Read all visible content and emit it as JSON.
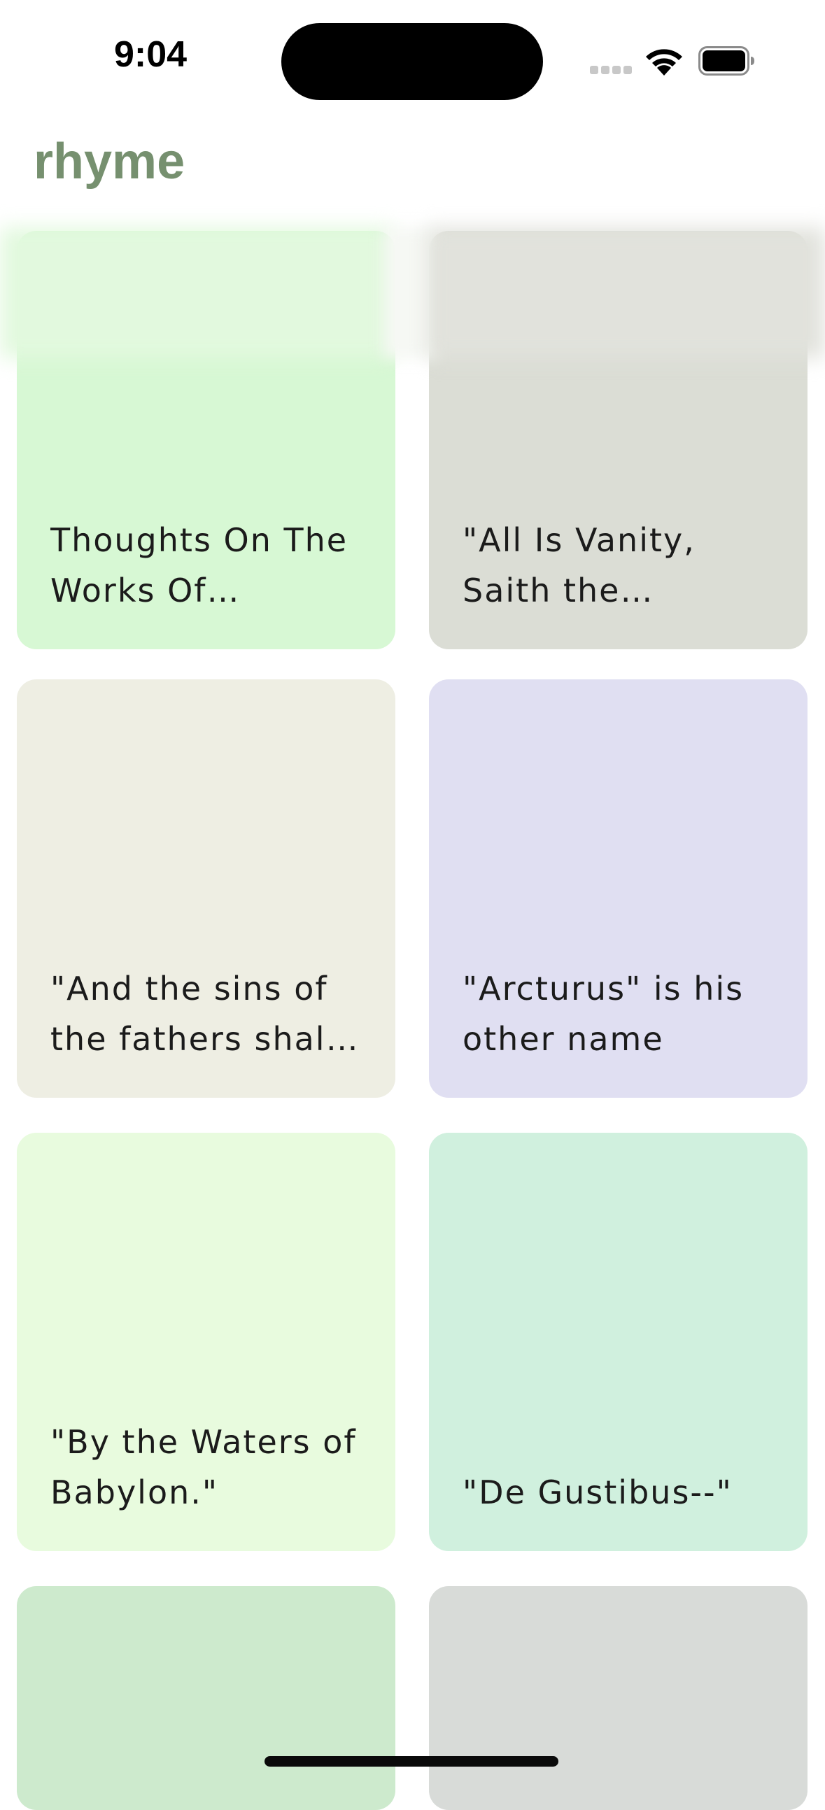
{
  "status_bar": {
    "time": "9:04",
    "icons": [
      "cellular-signal-icon",
      "wifi-icon",
      "battery-icon"
    ]
  },
  "header": {
    "title": "rhyme"
  },
  "colors": {
    "header_title": "#76906f",
    "card_text": "#1b1b1b"
  },
  "cards": [
    {
      "title": "Thoughts On The Works Of Providence",
      "color": "#d7f8d4"
    },
    {
      "title": "\"All Is Vanity, Saith the Preacher.\"",
      "color": "#dbddd5"
    },
    {
      "title": "\"And the sins of the fathers shall be visited upon the children\"",
      "color": "#eeeee3"
    },
    {
      "title": "\"Arcturus\" is his other name",
      "color": "#e0dff2"
    },
    {
      "title": "\"By the Waters of Babylon.\"",
      "color": "#e8fbde"
    },
    {
      "title": "\"De Gustibus--\"",
      "color": "#d0f0de"
    },
    {
      "title": "",
      "color": "#cdeacd"
    },
    {
      "title": "",
      "color": "#d8dbd8"
    }
  ]
}
